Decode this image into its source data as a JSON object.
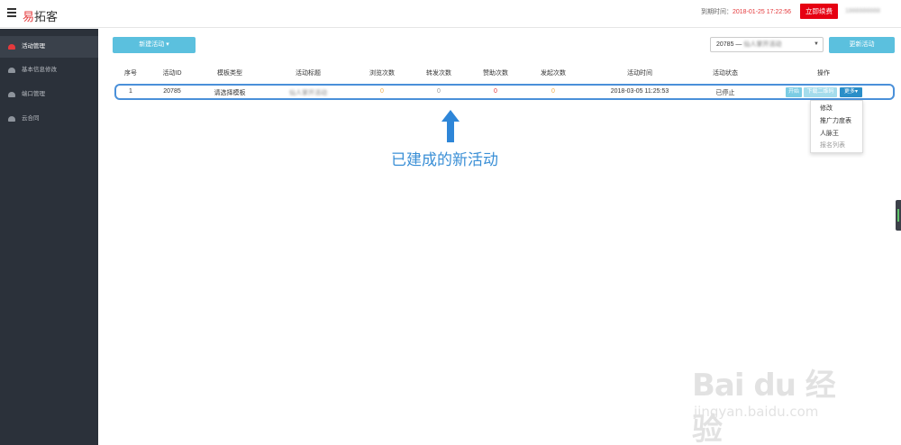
{
  "header": {
    "logo_accent": "易",
    "logo_rest": "拓客",
    "expire_label": "到期时间：",
    "expire_date": "2018-01-25 17:22:56",
    "renew_label": "立即续费",
    "user_id": "1888888888"
  },
  "sidebar": {
    "items": [
      {
        "label": "活动管理"
      },
      {
        "label": "基本信息修改"
      },
      {
        "label": "端口管理"
      },
      {
        "label": "云合同"
      }
    ]
  },
  "toolbar": {
    "new_activity_label": "新建活动",
    "activity_select_id": "20785 —",
    "activity_select_name": "仙人掌开活动",
    "update_label": "更新活动"
  },
  "table": {
    "headers": [
      "序号",
      "活动ID",
      "模板类型",
      "活动标题",
      "浏览次数",
      "转发次数",
      "赞助次数",
      "发起次数",
      "活动时间",
      "活动状态",
      "操作"
    ],
    "row": {
      "index": "1",
      "id": "20785",
      "template": "请选择模板",
      "title": "仙人掌开活动",
      "views": "0",
      "shares": "0",
      "sponsors": "0",
      "launches": "0",
      "time": "2018-03-05 11:25:53",
      "status": "已停止"
    },
    "ops": {
      "start": "开始",
      "qr": "下载二维码",
      "more": "更多"
    }
  },
  "more_menu": [
    "修改",
    "推广力度表",
    "人脉王",
    "报名列表"
  ],
  "annotation": "已建成的新活动",
  "watermark": {
    "main": "Bai du 经验",
    "sub": "jingyan.baidu.com"
  },
  "colors": {
    "accent_red": "#e60012",
    "info_blue": "#5bc0de",
    "annotation_blue": "#3a8fd6",
    "sidebar_bg": "#2b313a"
  }
}
